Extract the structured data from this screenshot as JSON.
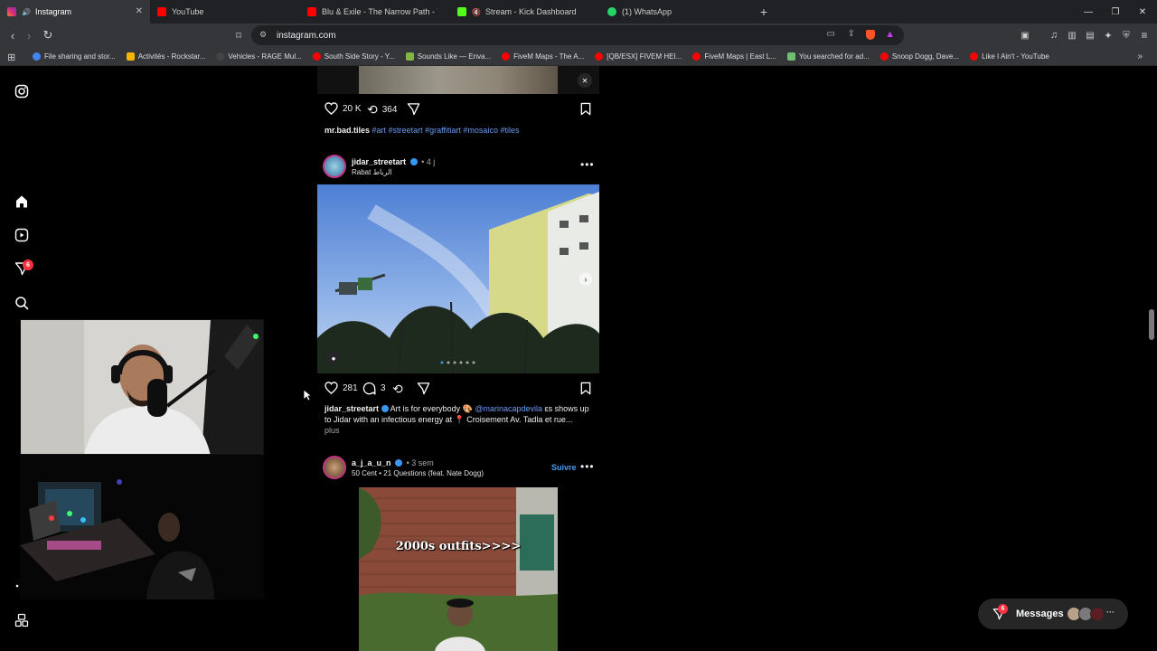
{
  "browser": {
    "tabs": [
      {
        "title": "Instagram",
        "icon": "instagram-icon",
        "color": "#e1306c",
        "active": true
      },
      {
        "title": "YouTube",
        "icon": "youtube-icon",
        "color": "#ff0000"
      },
      {
        "title": "Blu & Exile - The Narrow Path - YouT",
        "icon": "youtube-icon",
        "color": "#ff0000"
      },
      {
        "title": "Stream - Kick Dashboard",
        "icon": "kick-icon",
        "color": "#53fc18"
      },
      {
        "title": "(1) WhatsApp",
        "icon": "whatsapp-icon",
        "color": "#25d366"
      }
    ],
    "url": "instagram.com",
    "bookmarks": [
      {
        "label": "File sharing and stor...",
        "color": "#4285f4"
      },
      {
        "label": "Activités - Rockstar...",
        "color": "#f4b400"
      },
      {
        "label": "Vehicles - RAGE Mul...",
        "color": "#222222"
      },
      {
        "label": "South Side Story - Y...",
        "color": "#ff0000"
      },
      {
        "label": "Sounds Like — Enva...",
        "color": "#82b541"
      },
      {
        "label": "FiveM Maps - The A...",
        "color": "#ff0000"
      },
      {
        "label": "[QB/ESX] FIVEM HEI...",
        "color": "#ff0000"
      },
      {
        "label": "FiveM Maps | East L...",
        "color": "#ff0000"
      },
      {
        "label": "You searched for ad...",
        "color": "#6fbf73"
      },
      {
        "label": "Snoop Dogg, Dave...",
        "color": "#ff0000"
      },
      {
        "label": "Like I Ain't - YouTube",
        "color": "#ff0000"
      }
    ]
  },
  "sidebar": {
    "notification_count": "6"
  },
  "post1": {
    "likes": "20 K",
    "reposts": "364",
    "handle": "mr.bad.tiles",
    "tags": "#art #streetart #graffitiart #mosaico #tiles"
  },
  "post2": {
    "handle": "jidar_streetart",
    "time": "• 4 j",
    "location": "Rabat الرباط",
    "likes": "281",
    "comments": "3",
    "caption_text": "Art is for everybody 🎨",
    "caption_mention": "@marinacapdevila",
    "caption_rest": "ɛs shows up to Jidar with an infectious energy at 📍 Croisement Av. Tadla et rue...",
    "more": "plus"
  },
  "post3": {
    "handle": "a_j_a_u_n",
    "time": "• 3 sem",
    "audio": "50 Cent • 21 Questions (feat. Nate Dogg)",
    "follow": "Suivre",
    "overlay_text": "2000s outfits>>>>"
  },
  "messages": {
    "label": "Messages",
    "badge": "6"
  }
}
